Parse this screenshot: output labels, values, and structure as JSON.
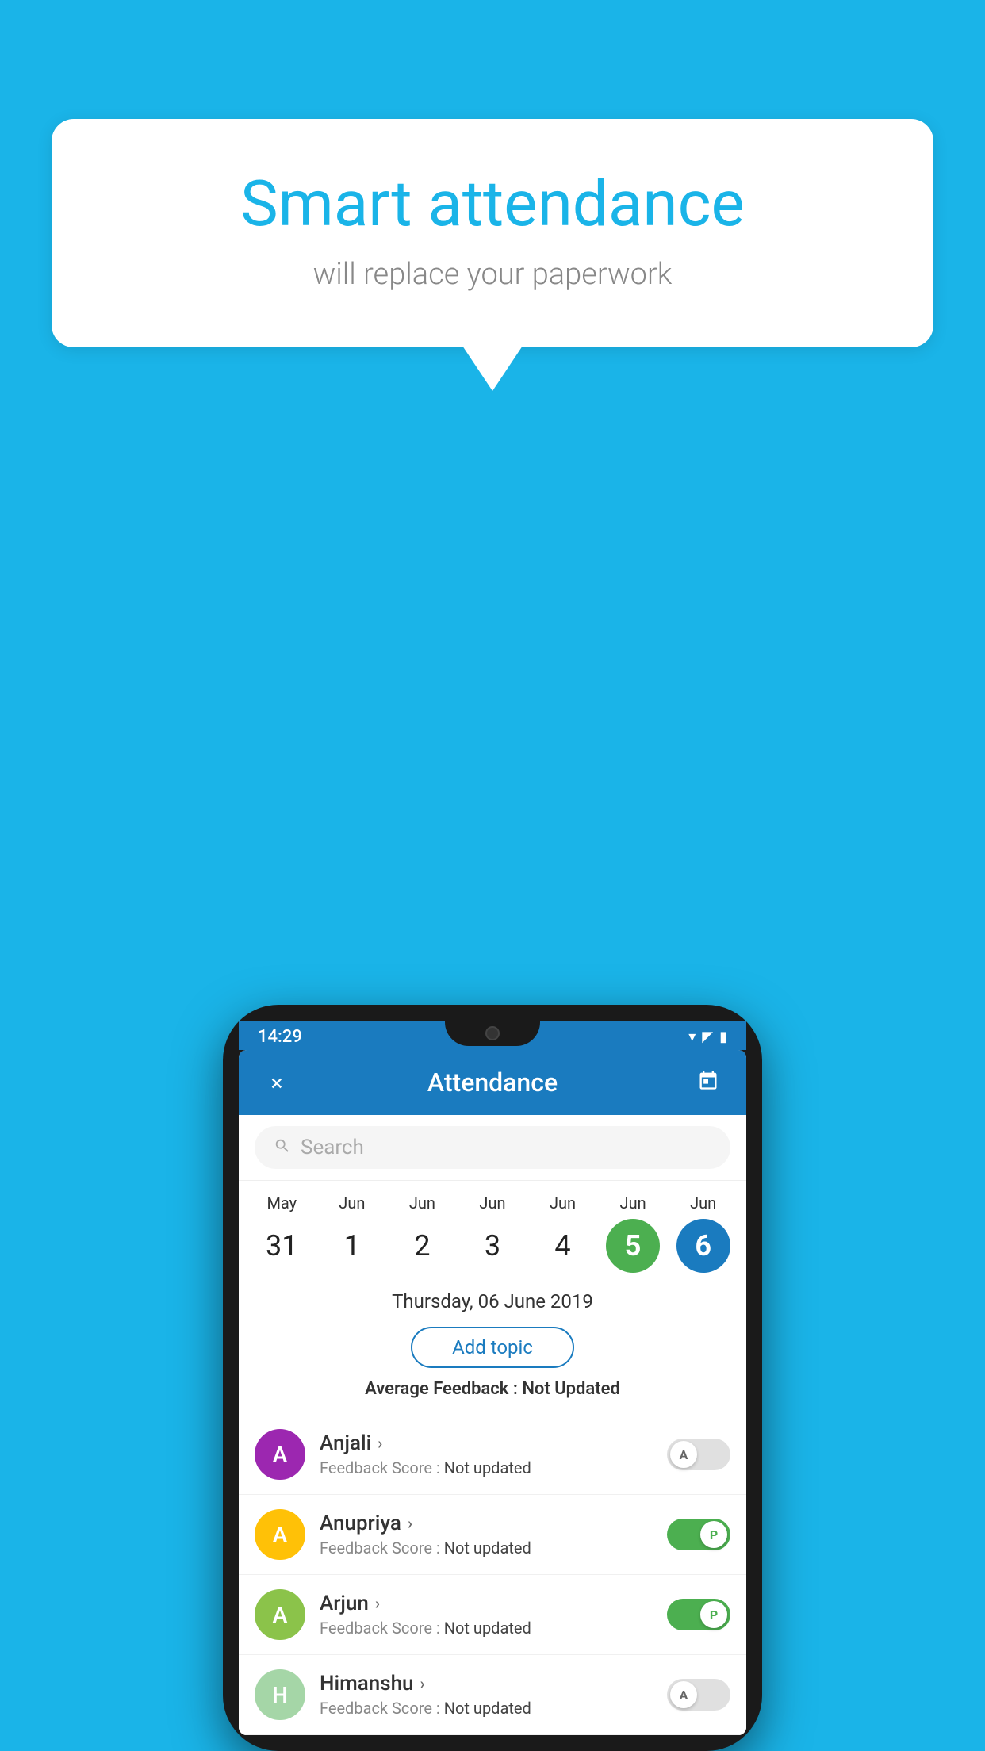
{
  "background_color": "#1ab4e8",
  "speech_bubble": {
    "title": "Smart attendance",
    "subtitle": "will replace your paperwork"
  },
  "phone": {
    "time": "14:29",
    "header": {
      "title": "Attendance",
      "close_label": "×",
      "calendar_label": "📅"
    },
    "search": {
      "placeholder": "Search"
    },
    "dates": [
      {
        "month": "May",
        "day": "31",
        "state": "normal"
      },
      {
        "month": "Jun",
        "day": "1",
        "state": "normal"
      },
      {
        "month": "Jun",
        "day": "2",
        "state": "normal"
      },
      {
        "month": "Jun",
        "day": "3",
        "state": "normal"
      },
      {
        "month": "Jun",
        "day": "4",
        "state": "normal"
      },
      {
        "month": "Jun",
        "day": "5",
        "state": "today"
      },
      {
        "month": "Jun",
        "day": "6",
        "state": "selected"
      }
    ],
    "selected_date_label": "Thursday, 06 June 2019",
    "add_topic_label": "Add topic",
    "avg_feedback_label": "Average Feedback :",
    "avg_feedback_value": "Not Updated",
    "students": [
      {
        "name": "Anjali",
        "initial": "A",
        "avatar_color": "#9c27b0",
        "feedback_label": "Feedback Score :",
        "feedback_value": "Not updated",
        "attendance": "absent",
        "toggle_label": "A"
      },
      {
        "name": "Anupriya",
        "initial": "A",
        "avatar_color": "#ffc107",
        "feedback_label": "Feedback Score :",
        "feedback_value": "Not updated",
        "attendance": "present",
        "toggle_label": "P"
      },
      {
        "name": "Arjun",
        "initial": "A",
        "avatar_color": "#8bc34a",
        "feedback_label": "Feedback Score :",
        "feedback_value": "Not updated",
        "attendance": "present",
        "toggle_label": "P"
      },
      {
        "name": "Himanshu",
        "initial": "H",
        "avatar_color": "#a5d6a7",
        "feedback_label": "Feedback Score :",
        "feedback_value": "Not updated",
        "attendance": "absent",
        "toggle_label": "A"
      }
    ]
  }
}
